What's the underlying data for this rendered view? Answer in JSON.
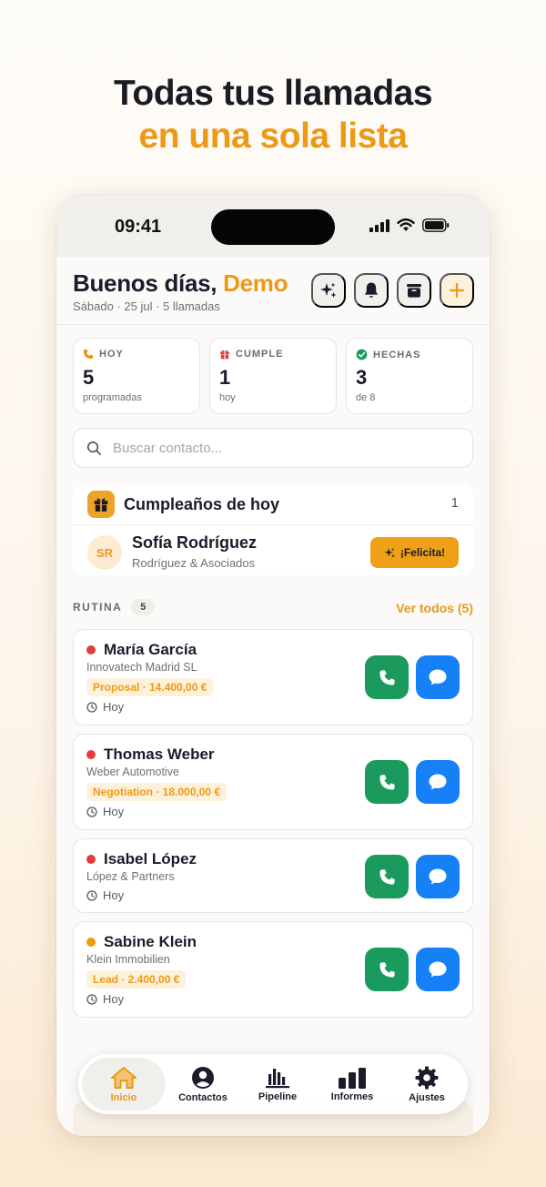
{
  "hero": {
    "line1": "Todas tus llamadas",
    "line2": "en una sola lista"
  },
  "status": {
    "time": "09:41"
  },
  "header": {
    "greeting": "Buenos días, ",
    "name": "Demo",
    "subtitle": "Sábado · 25 jul · 5 llamadas"
  },
  "actions": [
    {
      "name": "sparkles-icon"
    },
    {
      "name": "bell-icon"
    },
    {
      "name": "archive-icon"
    },
    {
      "name": "plus-icon"
    }
  ],
  "stats": [
    {
      "label": "HOY",
      "value": "5",
      "sub": "programadas",
      "icon": "phone-icon",
      "color": "#e8950f"
    },
    {
      "label": "CUMPLE",
      "value": "1",
      "sub": "hoy",
      "icon": "gift-icon",
      "color": "#e53b3b"
    },
    {
      "label": "HECHAS",
      "value": "3",
      "sub": "de 8",
      "icon": "check-circle-icon",
      "color": "#1a9a5c"
    }
  ],
  "search": {
    "placeholder": "Buscar contacto..."
  },
  "birthdays": {
    "title": "Cumpleaños de hoy",
    "count": "1",
    "person": {
      "initials": "SR",
      "name": "Sofía Rodríguez",
      "company": "Rodríguez & Asociados"
    },
    "button_label": "¡Felicita!"
  },
  "routine": {
    "label": "RUTINA",
    "count": "5",
    "see_all": "Ver todos (5)",
    "contacts": [
      {
        "name": "María García",
        "company": "Innovatech Madrid SL",
        "tag": "Proposal · 14.400,00 €",
        "when": "Hoy",
        "dot": "#e53b3b"
      },
      {
        "name": "Thomas Weber",
        "company": "Weber Automotive",
        "tag": "Negotiation · 18.000,00 €",
        "when": "Hoy",
        "dot": "#e53b3b"
      },
      {
        "name": "Isabel López",
        "company": "López & Partners",
        "tag": "",
        "when": "Hoy",
        "dot": "#e53b3b"
      },
      {
        "name": "Sabine Klein",
        "company": "Klein Immobilien",
        "tag": "Lead · 2.400,00 €",
        "when": "Hoy",
        "dot": "#f09a0e"
      }
    ]
  },
  "tabs": [
    {
      "label": "Inicio",
      "icon": "home-icon",
      "active": true
    },
    {
      "label": "Contactos",
      "icon": "person-icon"
    },
    {
      "label": "Pipeline",
      "icon": "pipeline-icon"
    },
    {
      "label": "Informes",
      "icon": "bar-chart-icon"
    },
    {
      "label": "Ajustes",
      "icon": "gear-icon"
    }
  ],
  "colors": {
    "accent": "#ec9a15",
    "call": "#1a9a5c",
    "message": "#1680f6"
  }
}
